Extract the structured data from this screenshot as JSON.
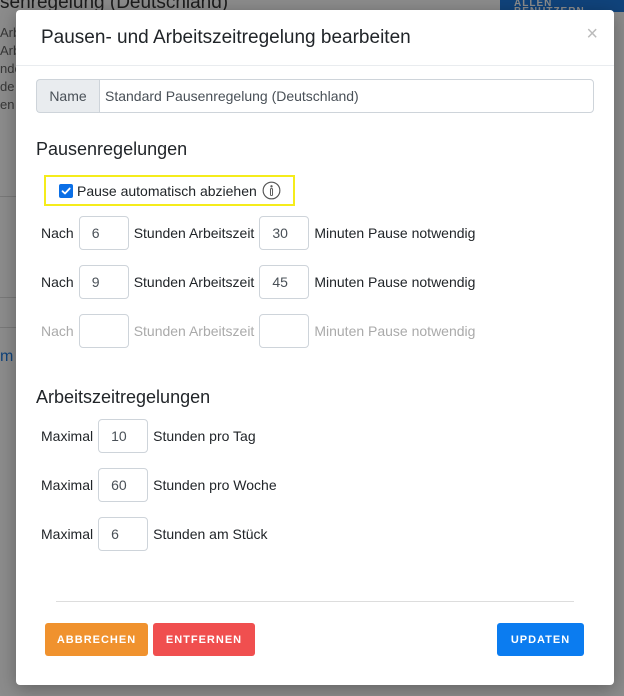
{
  "background": {
    "heading": "senregelung (Deutschland)",
    "button": "ALLEN BENUTZERN",
    "text_lines": [
      "Arb",
      "Arb",
      "nden",
      "de",
      "en"
    ],
    "link": "m"
  },
  "modal": {
    "title": "Pausen- und Arbeitszeitregelung bearbeiten",
    "close": "×",
    "name": {
      "label": "Name",
      "value": "Standard Pausenregelung (Deutschland)"
    },
    "pause_section": {
      "title": "Pausenregelungen",
      "auto_deduct": {
        "label": "Pause automatisch abziehen",
        "checked": true
      },
      "rules": [
        {
          "prefix": "Nach",
          "hours": "6",
          "hours_label": "Stunden Arbeitszeit",
          "minutes": "30",
          "minutes_label": "Minuten Pause notwendig"
        },
        {
          "prefix": "Nach",
          "hours": "9",
          "hours_label": "Stunden Arbeitszeit",
          "minutes": "45",
          "minutes_label": "Minuten Pause notwendig"
        },
        {
          "prefix": "Nach",
          "hours": "",
          "hours_label": "Stunden Arbeitszeit",
          "minutes": "",
          "minutes_label": "Minuten Pause notwendig"
        }
      ]
    },
    "work_section": {
      "title": "Arbeitszeitregelungen",
      "rules": [
        {
          "prefix": "Maximal",
          "value": "10",
          "suffix": "Stunden pro Tag"
        },
        {
          "prefix": "Maximal",
          "value": "60",
          "suffix": "Stunden pro Woche"
        },
        {
          "prefix": "Maximal",
          "value": "6",
          "suffix": "Stunden am Stück"
        }
      ]
    },
    "buttons": {
      "cancel": "ABBRECHEN",
      "remove": "ENTFERNEN",
      "update": "UPDATEN"
    }
  },
  "colors": {
    "highlight": "#f5ec1b",
    "primary": "#0b7cf0",
    "cancel": "#f0922e",
    "remove": "#f04f4f"
  },
  "icons": [
    "close-icon",
    "checkmark-icon",
    "info-icon"
  ]
}
